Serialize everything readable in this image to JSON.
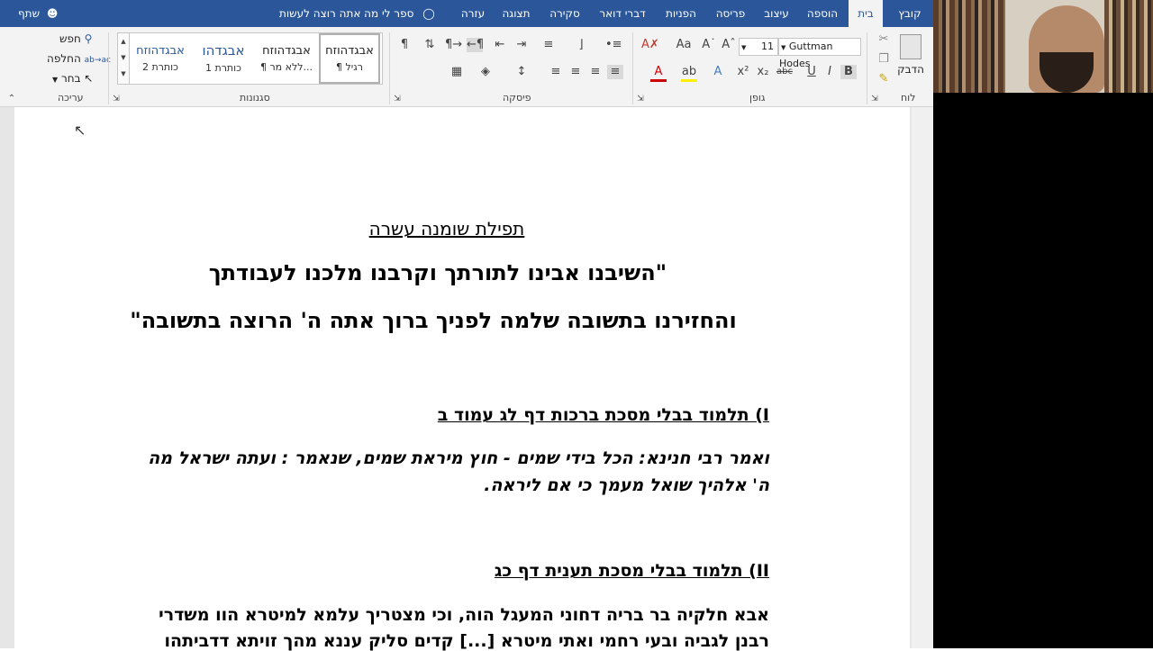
{
  "tabs": [
    {
      "label": "קובץ",
      "active": false
    },
    {
      "label": "בית",
      "active": true
    },
    {
      "label": "הוספה",
      "active": false
    },
    {
      "label": "עיצוב",
      "active": false
    },
    {
      "label": "פריסה",
      "active": false
    },
    {
      "label": "הפניות",
      "active": false
    },
    {
      "label": "דברי דואר",
      "active": false
    },
    {
      "label": "סקירה",
      "active": false
    },
    {
      "label": "תצוגה",
      "active": false
    },
    {
      "label": "עזרה",
      "active": false
    }
  ],
  "tell_me": "ספר לי מה אתה רוצה לעשות",
  "share": "שתף",
  "ribbon": {
    "groups": {
      "clipboard": "לוח",
      "font": "גופן",
      "paragraph": "פיסקה",
      "styles": "סגנונות",
      "editing": "עריכה"
    },
    "paste_label": "הדבק",
    "font_name": "Guttman Hodes",
    "font_size": "11",
    "editing": {
      "find": "חפש",
      "replace": "החלפה",
      "select": "בחר"
    },
    "styles": [
      {
        "sample": "אבגדהוזח",
        "name": "¶ רגיל"
      },
      {
        "sample": "אבגדהוזח",
        "name": "¶ ללא מר..."
      },
      {
        "sample": "אבגדהו",
        "name": "כותרת 1"
      },
      {
        "sample": "אבגדהוזח",
        "name": "כותרת 2"
      }
    ]
  },
  "document": {
    "heading": "תפילת שומנה עשרה",
    "quote_line1": "\"השיבנו אבינו לתורתך וקרבנו מלכנו לעבודתך",
    "quote_line2": "והחזירנו בתשובה שלמה לפניך ברוך אתה ה' הרוצה בתשובה\"",
    "section1_title": "I) תלמוד בבלי מסכת ברכות דף לג עמוד ב",
    "section1_line1": "ואמר רבי חנינא: הכל בידי שמים - חוץ מיראת שמים, שנאמר : ועתה ישראל מה",
    "section1_line2": "ה' אלהיך שואל מעמך כי אם ליראה.",
    "section2_title": "II) תלמוד בבלי מסכת תענית דף כג",
    "section2_line1": "אבא חלקיה בר בריה דחוני המעגל הוה, וכי מצטריך עלמא למיטרא הוו משדרי",
    "section2_line2": "רבנן לגביה ובעי רחמי ואתי מיטרא [...] קדים סליק עננא מהך זויתא דדביתהו"
  }
}
